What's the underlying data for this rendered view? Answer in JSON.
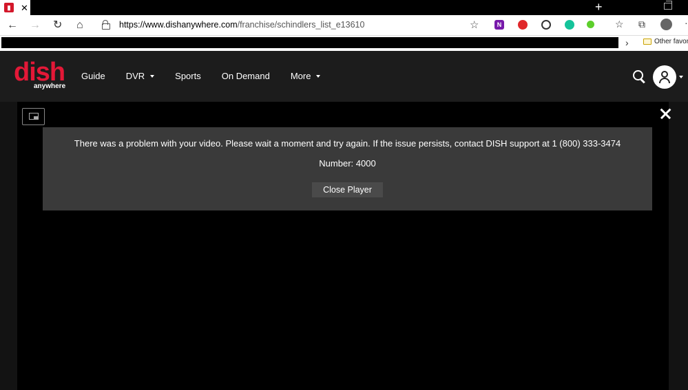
{
  "browser": {
    "tab_close": "✕",
    "new_tab": "+",
    "address": {
      "scheme_host": "https://www.dishanywhere.com",
      "path": "/franchise/schindlers_list_e13610"
    },
    "ext_onenote": "N",
    "favorites": {
      "chevron": "›",
      "other_label": "Other favor"
    }
  },
  "site": {
    "logo": "dish",
    "logo_sub": "anywhere",
    "menu": [
      "Guide",
      "DVR",
      "Sports",
      "On Demand",
      "More"
    ],
    "brand_color": "#e31837"
  },
  "player": {
    "error_message": "There was a problem with your video. Please wait a moment and try again. If the issue persists, contact DISH support at 1 (800) 333-3474",
    "error_number": "Number: 4000",
    "close_player_label": "Close Player"
  }
}
